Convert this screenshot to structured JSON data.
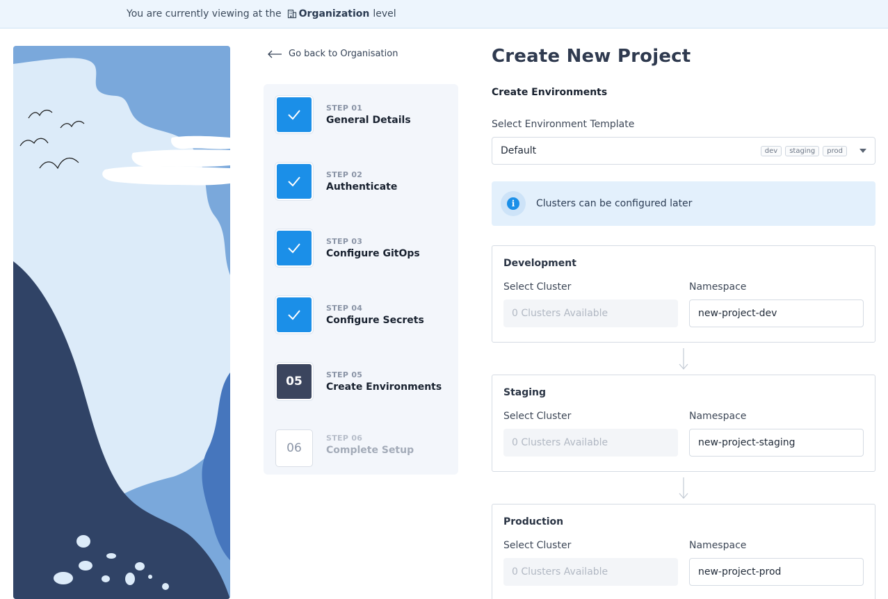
{
  "banner": {
    "prefix": "You are currently viewing at the",
    "level": "Organization",
    "suffix": "level"
  },
  "back_link": {
    "label": "Go back to Organisation"
  },
  "steps": [
    {
      "num": "STEP 01",
      "name": "General Details",
      "status": "done"
    },
    {
      "num": "STEP 02",
      "name": "Authenticate",
      "status": "done"
    },
    {
      "num": "STEP 03",
      "name": "Configure GitOps",
      "status": "done"
    },
    {
      "num": "STEP 04",
      "name": "Configure Secrets",
      "status": "done"
    },
    {
      "num": "STEP 05",
      "name": "Create Environments",
      "status": "current",
      "badge": "05"
    },
    {
      "num": "STEP 06",
      "name": "Complete Setup",
      "status": "pending",
      "badge": "06"
    }
  ],
  "page": {
    "title": "Create New Project",
    "section": "Create Environments",
    "template_label": "Select Environment Template",
    "template_value": "Default",
    "template_tags": [
      "dev",
      "staging",
      "prod"
    ],
    "info_text": "Clusters can be configured later"
  },
  "environments": [
    {
      "name": "Development",
      "cluster_label": "Select Cluster",
      "cluster_value": "0 Clusters Available",
      "ns_label": "Namespace",
      "ns_value": "new-project-dev"
    },
    {
      "name": "Staging",
      "cluster_label": "Select Cluster",
      "cluster_value": "0 Clusters Available",
      "ns_label": "Namespace",
      "ns_value": "new-project-staging"
    },
    {
      "name": "Production",
      "cluster_label": "Select Cluster",
      "cluster_value": "0 Clusters Available",
      "ns_label": "Namespace",
      "ns_value": "new-project-prod"
    }
  ],
  "colors": {
    "accent": "#1b8fe8",
    "current_step": "#3b455e",
    "banner_bg": "#edf5fd",
    "info_bg": "#e3f0fc"
  },
  "icons": {
    "banner": "building-icon",
    "back": "arrow-left-icon",
    "step_done": "checkmark-icon",
    "info": "info-icon",
    "select": "caret-down-icon",
    "connector": "arrow-down-icon"
  }
}
